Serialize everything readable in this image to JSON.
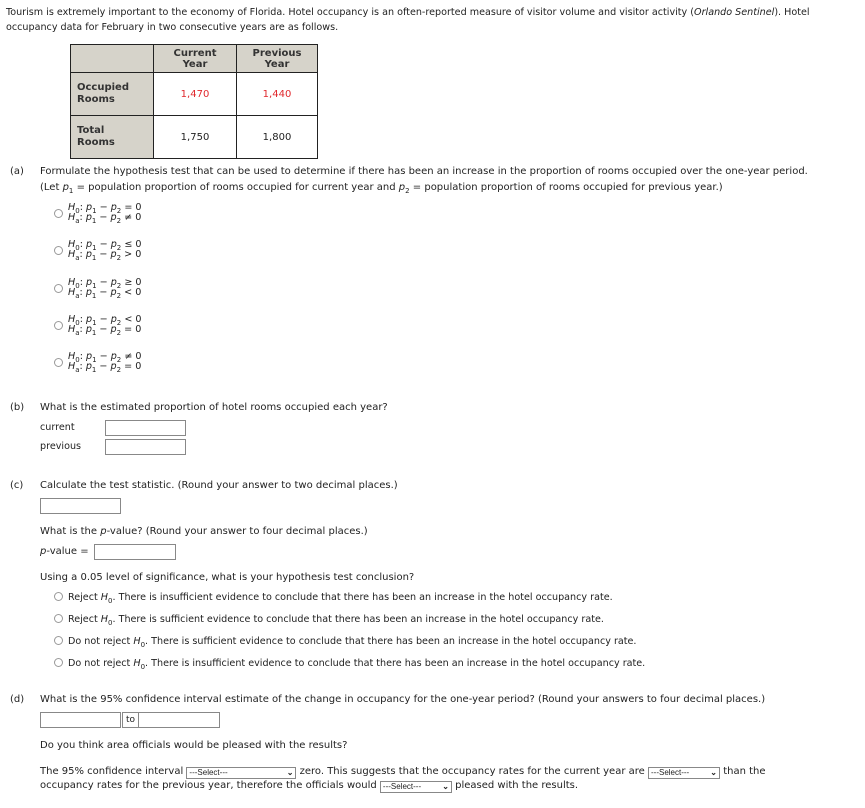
{
  "intro": {
    "text_before": "Tourism is extremely important to the economy of Florida. Hotel occupancy is an often-reported measure of visitor volume and visitor activity (",
    "source_italic": "Orlando Sentinel",
    "text_after": "). Hotel occupancy data for February in two consecutive years are as follows."
  },
  "table": {
    "headers": [
      "",
      "Current Year",
      "Previous Year"
    ],
    "rows": [
      {
        "label_line1": "Occupied",
        "label_line2": "Rooms",
        "current": "1,470",
        "previous": "1,440",
        "highlight": true
      },
      {
        "label_line1": "Total",
        "label_line2": "Rooms",
        "current": "1,750",
        "previous": "1,800",
        "highlight": false
      }
    ],
    "highlight_color": "#e0282d"
  },
  "part_a": {
    "label": "(a)",
    "question": "Formulate the hypothesis test that can be used to determine if there has been an increase in the proportion of rooms occupied over the one-year period.",
    "let_prefix": "(Let ",
    "let_p1_def": " = population proportion of rooms occupied for current year and ",
    "let_p2_def": " = population proportion of rooms occupied for previous year.)",
    "options": [
      {
        "h0": "p1 − p2 = 0",
        "ha": "p1 − p2 ≠ 0",
        "h0_rel": "= 0",
        "ha_rel": "≠ 0"
      },
      {
        "h0": "p1 − p2 ≤ 0",
        "ha": "p1 − p2 > 0",
        "h0_rel": "≤ 0",
        "ha_rel": "> 0"
      },
      {
        "h0": "p1 − p2 ≥ 0",
        "ha": "p1 − p2 < 0",
        "h0_rel": "≥ 0",
        "ha_rel": "< 0"
      },
      {
        "h0": "p1 − p2 < 0",
        "ha": "p1 − p2 = 0",
        "h0_rel": "< 0",
        "ha_rel": "= 0"
      },
      {
        "h0": "p1 − p2 ≠ 0",
        "ha": "p1 − p2 = 0",
        "h0_rel": "≠ 0",
        "ha_rel": "= 0"
      }
    ]
  },
  "part_b": {
    "label": "(b)",
    "question": "What is the estimated proportion of hotel rooms occupied each year?",
    "current_label": "current",
    "previous_label": "previous",
    "current_value": "",
    "previous_value": ""
  },
  "part_c": {
    "label": "(c)",
    "question": "Calculate the test statistic. (Round your answer to two decimal places.)",
    "test_stat_value": "",
    "pvalue_q_before": "What is the ",
    "pvalue_q_italic": "p",
    "pvalue_q_after": "-value? (Round your answer to four decimal places.)",
    "pvalue_label_italic": "p",
    "pvalue_label_rest": "-value =",
    "pvalue_value": "",
    "conclusion_question": "Using a 0.05 level of significance, what is your hypothesis test conclusion?",
    "conclusions": [
      {
        "prefix": "Reject ",
        "rest": ". There is insufficient evidence to conclude that there has been an increase in the hotel occupancy rate."
      },
      {
        "prefix": "Reject ",
        "rest": ". There is sufficient evidence to conclude that there has been an increase in the hotel occupancy rate."
      },
      {
        "prefix": "Do not reject ",
        "rest": ". There is sufficient evidence to conclude that there has been an increase in the hotel occupancy rate."
      },
      {
        "prefix": "Do not reject ",
        "rest": ". There is insufficient evidence to conclude that there has been an increase in the hotel occupancy rate."
      }
    ]
  },
  "part_d": {
    "label": "(d)",
    "question": "What is the 95% confidence interval estimate of the change in occupancy for the one-year period? (Round your answers to four decimal places.)",
    "lower_value": "",
    "to_label": "to",
    "upper_value": "",
    "pleased_question": "Do you think area officials would be pleased with the results?",
    "sentence_part1": "The 95% confidence interval",
    "sentence_part2": "zero. This suggests that the occupancy rates for the current year are",
    "sentence_part3": "than the",
    "sentence_part4": "occupancy rates for the previous year, therefore the officials would",
    "sentence_part5": "pleased with the results.",
    "select_placeholder": "---Select---",
    "select1_value": "---Select---",
    "select2_value": "---Select---",
    "select3_value": "---Select---"
  }
}
